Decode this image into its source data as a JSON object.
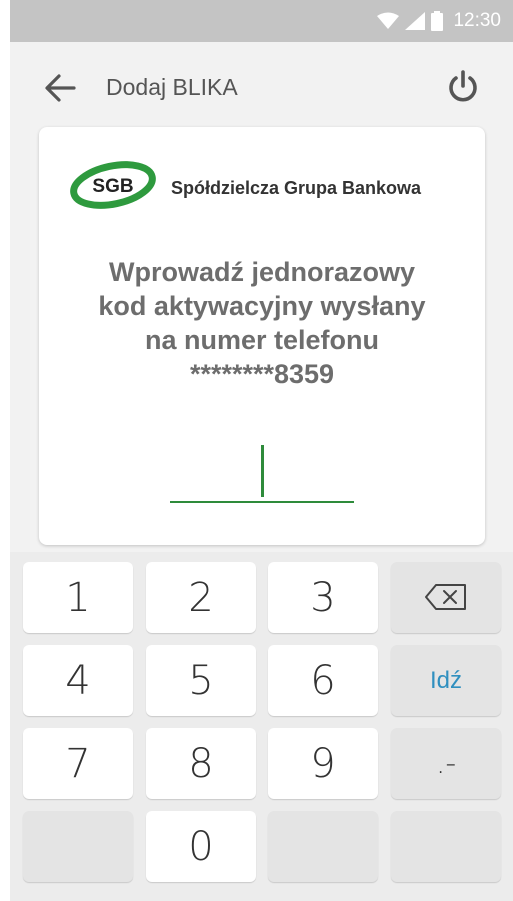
{
  "status_bar": {
    "time": "12:30",
    "icons": [
      "wifi-icon",
      "signal-icon",
      "battery-icon"
    ]
  },
  "app_bar": {
    "title": "Dodaj BLIKA",
    "back_icon": "arrow-left-icon",
    "power_icon": "power-icon"
  },
  "card": {
    "logo_text": "SGB",
    "bank_name": "Spółdzielcza Grupa Bankowa",
    "prompt_lines": [
      "Wprowadź jednorazowy",
      "kod aktywacyjny wysłany",
      "na numer telefonu",
      "********8359"
    ],
    "code_value": ""
  },
  "keyboard": {
    "rows": [
      [
        "1",
        "2",
        "3",
        "⌫"
      ],
      [
        "4",
        "5",
        "6",
        "Idź"
      ],
      [
        "7",
        "8",
        "9",
        ".-"
      ],
      [
        "",
        "0",
        "",
        ""
      ]
    ],
    "backspace_icon": "backspace-icon"
  },
  "colors": {
    "accent_green": "#2e8b3b",
    "status_bar": "#c4c4c4",
    "go_key_text": "#2f8fbf"
  }
}
